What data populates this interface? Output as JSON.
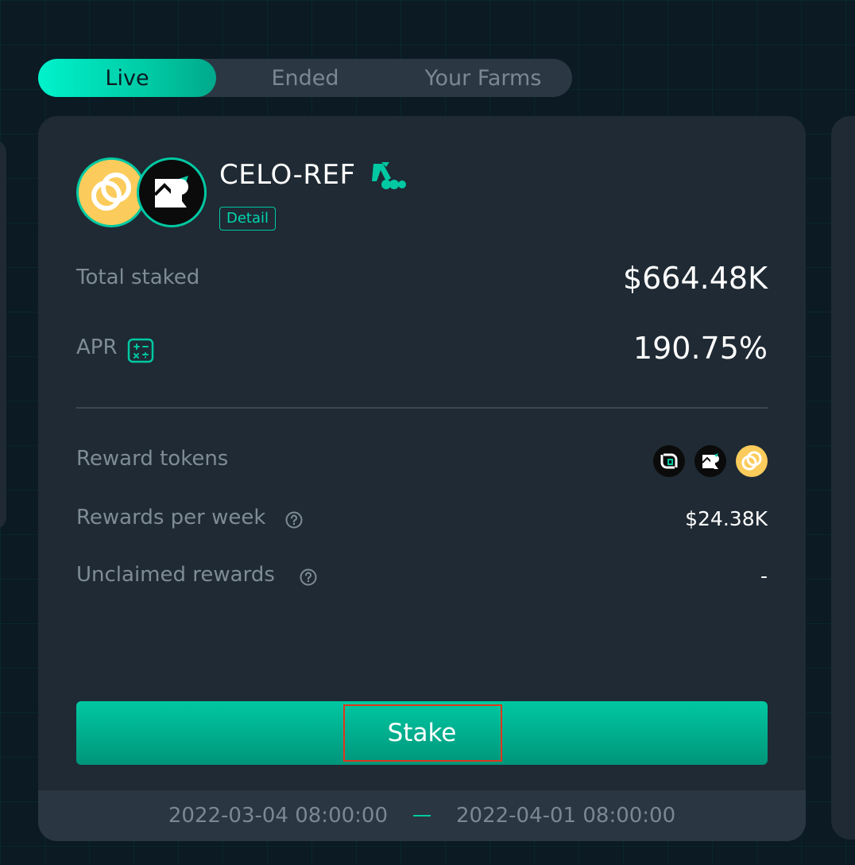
{
  "tabs": [
    {
      "label": "Live",
      "active": true
    },
    {
      "label": "Ended",
      "active": false
    },
    {
      "label": "Your Farms",
      "active": false
    }
  ],
  "farm": {
    "pair_name": "CELO-REF",
    "detail_label": "Detail",
    "tokens": [
      "celo-icon",
      "ref-icon"
    ],
    "boost_icon": "boost-icon",
    "total_staked_label": "Total staked",
    "total_staked_value": "$664.48K",
    "apr_label": "APR",
    "apr_value": "190.75%",
    "reward_tokens_label": "Reward tokens",
    "reward_tokens": [
      "aurora-like-icon",
      "ref-icon",
      "celo-icon"
    ],
    "rewards_per_week_label": "Rewards per week",
    "rewards_per_week_value": "$24.38K",
    "unclaimed_rewards_label": "Unclaimed rewards",
    "unclaimed_rewards_value": "-",
    "stake_label": "Stake",
    "start_time": "2022-03-04 08:00:00",
    "end_time": "2022-04-01 08:00:00"
  },
  "colors": {
    "accent": "#00c8a2",
    "background": "#0b1a23",
    "card": "#1f2a34",
    "celo": "#fbcc5c",
    "highlight": "#e0361b"
  }
}
